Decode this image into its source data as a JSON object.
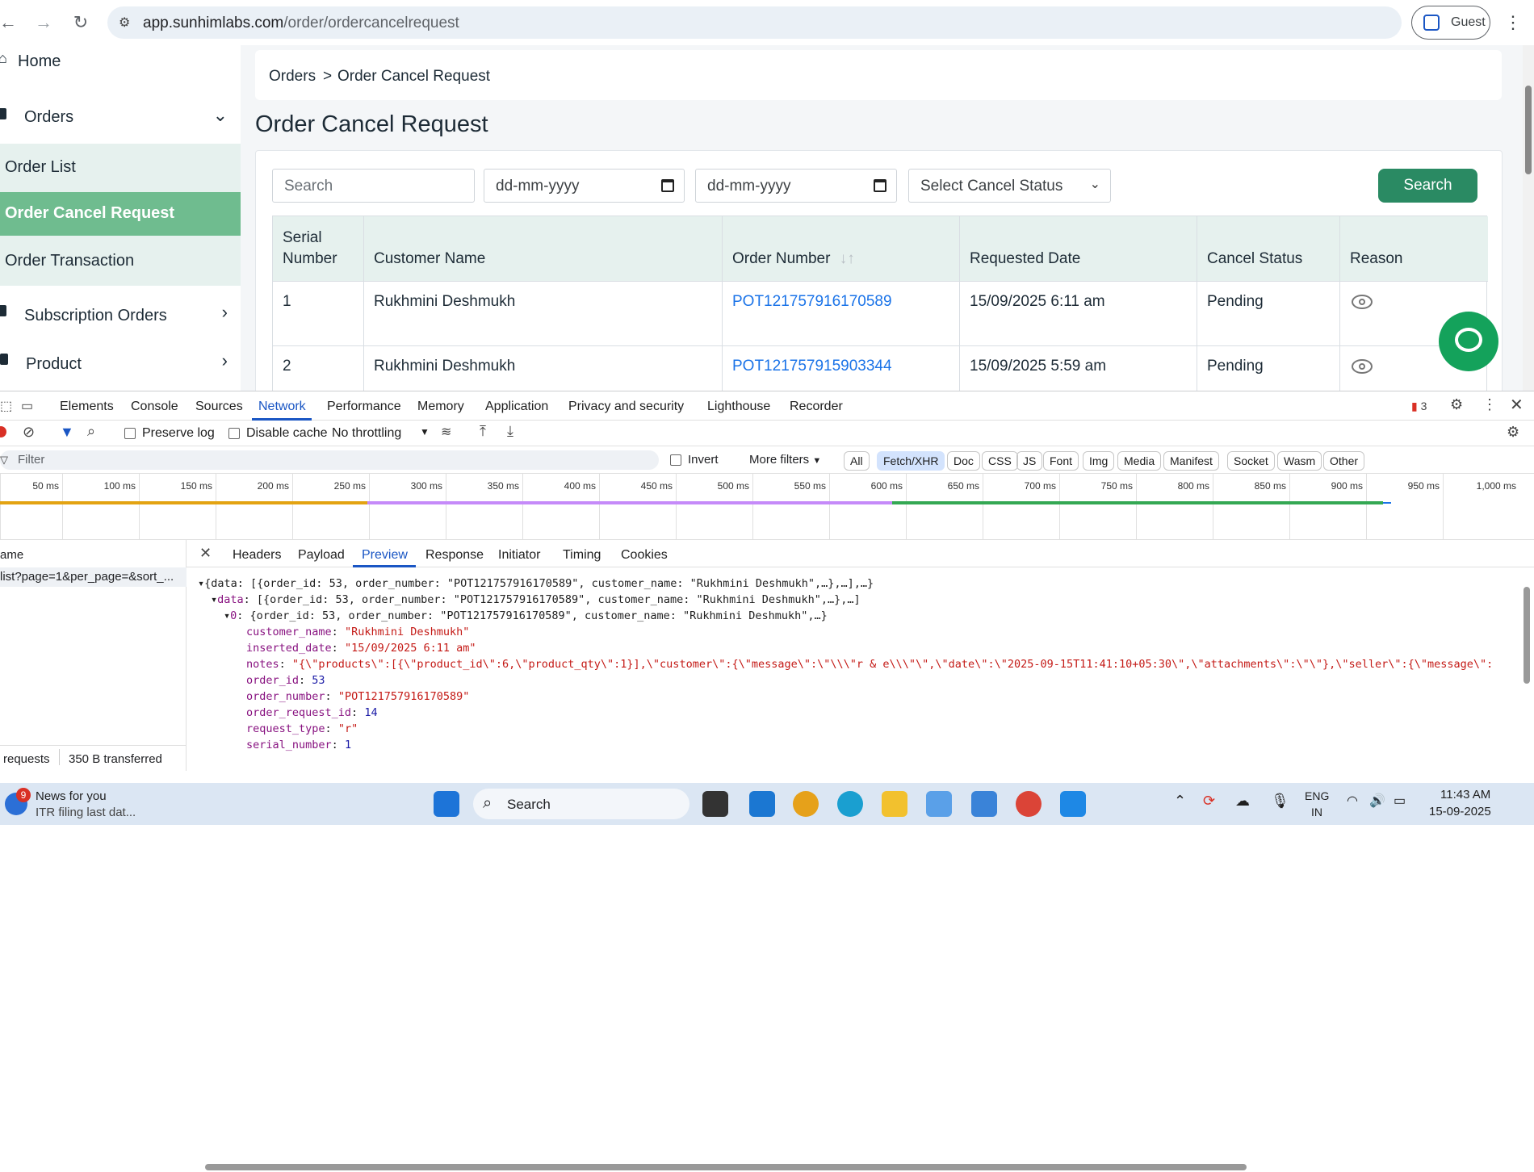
{
  "browser": {
    "url_domain": "app.sunhimlabs.com",
    "url_path": "/order/ordercancelrequest",
    "profile_label": "Guest"
  },
  "sidebar": {
    "items": [
      {
        "label": "Home"
      },
      {
        "label": "Orders"
      },
      {
        "label": "Order List"
      },
      {
        "label": "Order Cancel Request"
      },
      {
        "label": "Order Transaction"
      },
      {
        "label": "Subscription Orders"
      },
      {
        "label": "Product"
      }
    ]
  },
  "breadcrumb": {
    "parent": "Orders",
    "separator": ">",
    "current": "Order Cancel Request"
  },
  "page_title": "Order Cancel Request",
  "filters": {
    "search_placeholder": "Search",
    "date_from_placeholder": "dd-mm-yyyy",
    "date_to_placeholder": "dd-mm-yyyy",
    "status_select": "Select Cancel Status",
    "search_button": "Search"
  },
  "table": {
    "headers": [
      "Serial\nNumber",
      "Customer Name",
      "Order Number",
      "Requested Date",
      "Cancel Status",
      "Reason"
    ],
    "rows": [
      {
        "serial": "1",
        "customer": "Rukhmini Deshmukh",
        "order_number": "POT121757916170589",
        "date": "15/09/2025 6:11 am",
        "status": "Pending"
      },
      {
        "serial": "2",
        "customer": "Rukhmini Deshmukh",
        "order_number": "POT121757915903344",
        "date": "15/09/2025 5:59 am",
        "status": "Pending"
      }
    ]
  },
  "devtools": {
    "tabs": [
      "Elements",
      "Console",
      "Sources",
      "Network",
      "Performance",
      "Memory",
      "Application",
      "Privacy and security",
      "Lighthouse",
      "Recorder"
    ],
    "active_tab": "Network",
    "issues_count": "3",
    "toolbar": {
      "preserve_log": "Preserve log",
      "disable_cache": "Disable cache",
      "throttling": "No throttling"
    },
    "filter": {
      "placeholder": "Filter",
      "invert": "Invert",
      "more_filters": "More filters"
    },
    "type_chips": [
      "All",
      "Fetch/XHR",
      "Doc",
      "CSS",
      "JS",
      "Font",
      "Img",
      "Media",
      "Manifest",
      "Socket",
      "Wasm",
      "Other"
    ],
    "active_chip": "Fetch/XHR",
    "timeline_ticks": [
      "50 ms",
      "100 ms",
      "150 ms",
      "200 ms",
      "250 ms",
      "300 ms",
      "350 ms",
      "400 ms",
      "450 ms",
      "500 ms",
      "550 ms",
      "600 ms",
      "650 ms",
      "700 ms",
      "750 ms",
      "800 ms",
      "850 ms",
      "900 ms",
      "950 ms",
      "1,000 ms"
    ],
    "request_list": {
      "header": "ame",
      "item": "list?page=1&per_page=&sort_...",
      "footer_requests": "requests",
      "footer_transferred": "350 B transferred"
    },
    "detail_tabs": [
      "Headers",
      "Payload",
      "Preview",
      "Response",
      "Initiator",
      "Timing",
      "Cookies"
    ],
    "active_detail_tab": "Preview",
    "preview": {
      "line1": "{data: [{order_id: 53, order_number: \"POT121757916170589\", customer_name: \"Rukhmini Deshmukh\",…},…],…}",
      "line2_key": "data",
      "line2_val": "[{order_id: 53, order_number: \"POT121757916170589\", customer_name: \"Rukhmini Deshmukh\",…},…]",
      "line3_key": "0",
      "line3_val": "{order_id: 53, order_number: \"POT121757916170589\", customer_name: \"Rukhmini Deshmukh\",…}",
      "fields": [
        {
          "key": "customer_name",
          "value": "\"Rukhmini Deshmukh\"",
          "kind": "s"
        },
        {
          "key": "inserted_date",
          "value": "\"15/09/2025 6:11 am\"",
          "kind": "s"
        },
        {
          "key": "notes",
          "value": "\"{\\\"products\\\":[{\\\"product_id\\\":6,\\\"product_qty\\\":1}],\\\"customer\\\":{\\\"message\\\":\\\"\\\\\\\"r & e\\\\\\\"\\\",\\\"date\\\":\\\"2025-09-15T11:41:10+05:30\\\",\\\"attachments\\\":\\\"\\\"},\\\"seller\\\":{\\\"message\\\":",
          "kind": "s"
        },
        {
          "key": "order_id",
          "value": "53",
          "kind": "n"
        },
        {
          "key": "order_number",
          "value": "\"POT121757916170589\"",
          "kind": "s"
        },
        {
          "key": "order_request_id",
          "value": "14",
          "kind": "n"
        },
        {
          "key": "request_type",
          "value": "\"r\"",
          "kind": "s"
        },
        {
          "key": "serial_number",
          "value": "1",
          "kind": "n"
        }
      ]
    }
  },
  "taskbar": {
    "news_title": "News for you",
    "news_sub": "ITR filing last dat...",
    "news_badge": "9",
    "search_label": "Search",
    "lang_top": "ENG",
    "lang_bottom": "IN",
    "time": "11:43 AM",
    "date": "15-09-2025"
  }
}
